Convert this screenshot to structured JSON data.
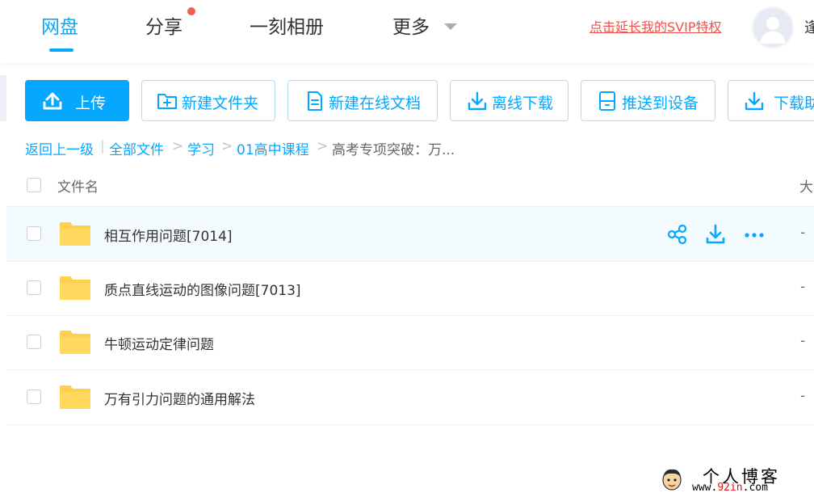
{
  "nav": {
    "tabs": [
      {
        "label": "网盘",
        "active": true
      },
      {
        "label": "分享",
        "has_badge": true
      },
      {
        "label": "一刻相册"
      },
      {
        "label": "更多",
        "has_dropdown": true
      }
    ],
    "svip_link": "点击延长我的SVIP特权",
    "username": "逢"
  },
  "toolbar": {
    "upload": "上传",
    "new_folder": "新建文件夹",
    "new_doc": "新建在线文档",
    "offline_download": "离线下载",
    "push_device": "推送到设备",
    "download": "下载助"
  },
  "breadcrumb": {
    "back": "返回上一级",
    "separator_bar": "|",
    "items": [
      "全部文件",
      "学习",
      "01高中课程"
    ],
    "current": "高考专项突破：万...",
    "separator": ">"
  },
  "table": {
    "header_name": "文件名",
    "header_size": "大",
    "rows": [
      {
        "name": "相互作用问题[7014]",
        "size": "-",
        "hovered": true
      },
      {
        "name": "质点直线运动的图像问题[7013]",
        "size": "-"
      },
      {
        "name": "牛顿运动定律问题",
        "size": "-"
      },
      {
        "name": "万有引力问题的通用解法",
        "size": "-"
      }
    ],
    "row_actions": [
      "share-icon",
      "download-icon",
      "more-icon"
    ]
  },
  "watermark": {
    "title": "个人博客",
    "url_prefix": "www.",
    "url_highlight": "92in",
    "url_suffix": ".com"
  },
  "colors": {
    "accent": "#06a7ff",
    "svip": "#f0524a",
    "folder": "#fdd04e",
    "badge": "#f25d4d"
  }
}
